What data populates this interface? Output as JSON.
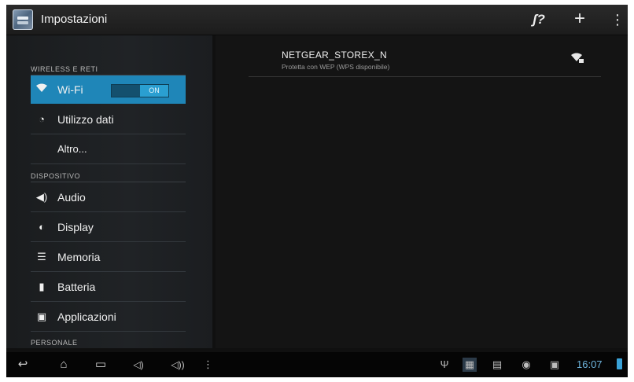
{
  "action_bar": {
    "title": "Impostazioni",
    "icons": [
      "settings-app-icon",
      "wps-icon",
      "add-network-icon",
      "overflow-menu-icon"
    ]
  },
  "left_panel": {
    "sections": [
      {
        "header": "WIRELESS E RETI",
        "items": [
          {
            "label": "Wi-Fi",
            "icon": "wifi-icon",
            "toggle": "ON",
            "selected": true
          },
          {
            "label": "Utilizzo dati",
            "icon": "data-usage-icon"
          },
          {
            "label": "Altro...",
            "icon": ""
          }
        ]
      },
      {
        "header": "DISPOSITIVO",
        "items": [
          {
            "label": "Audio",
            "icon": "volume-icon"
          },
          {
            "label": "Display",
            "icon": "brightness-icon"
          },
          {
            "label": "Memoria",
            "icon": "storage-icon"
          },
          {
            "label": "Batteria",
            "icon": "battery-icon"
          },
          {
            "label": "Applicazioni",
            "icon": "apps-icon"
          }
        ]
      },
      {
        "header": "PERSONALE",
        "items": []
      }
    ]
  },
  "right_panel": {
    "networks": [
      {
        "ssid": "NETGEAR_STOREX_N",
        "status": "Protetta con WEP (WPS disponibile)",
        "icon": "wifi-locked-icon"
      }
    ]
  },
  "system_bar": {
    "nav_icons": [
      "back-icon",
      "home-icon",
      "recent-apps-icon",
      "volume-down-icon",
      "volume-up-icon",
      "overflow-icon"
    ],
    "tray_icons": [
      "usb-icon",
      "screenshot-icon",
      "gallery-icon",
      "android-icon",
      "sd-card-icon"
    ],
    "clock": "16:07",
    "accent_color": "#33b5e5"
  }
}
